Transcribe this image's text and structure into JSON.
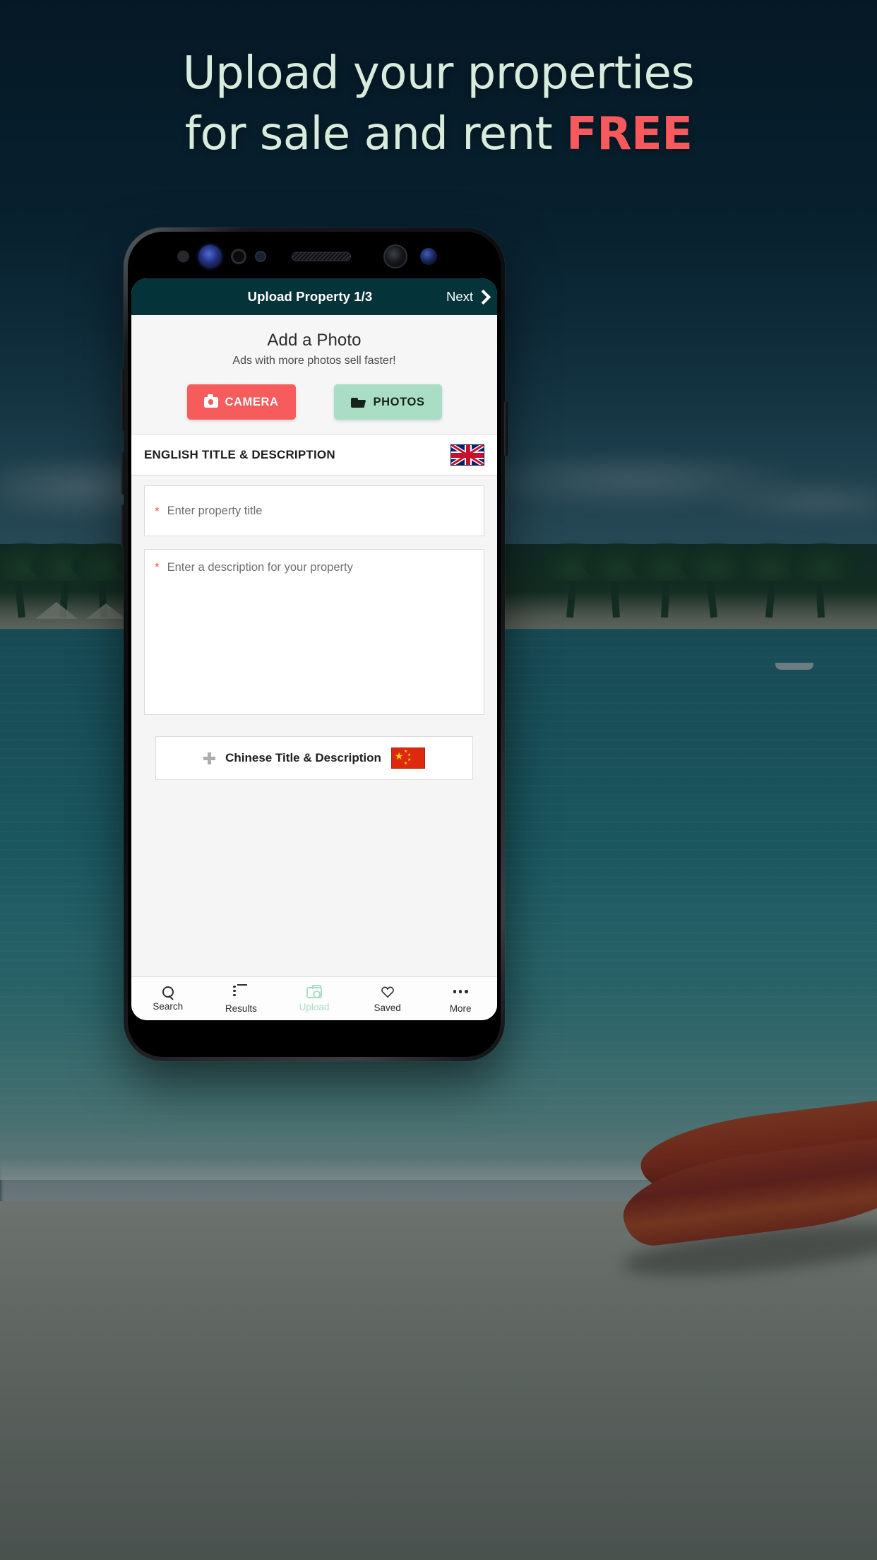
{
  "promo": {
    "line1": "Upload your properties",
    "line2_prefix": "for sale and rent ",
    "line2_highlight": "FREE",
    "text_color": "#d8ecdd",
    "highlight_color": "#f8595c"
  },
  "app": {
    "appbar": {
      "title": "Upload Property 1/3",
      "next_label": "Next",
      "background": "#05333a"
    },
    "photo_section": {
      "title": "Add a Photo",
      "subtitle": "Ads with more photos sell faster!",
      "camera_button": "CAMERA",
      "photos_button": "PHOTOS",
      "camera_color": "#f75c5c",
      "photos_color": "#a9dec5"
    },
    "language_section": {
      "header": "ENGLISH TITLE & DESCRIPTION",
      "flag": "uk-flag-icon",
      "title_field": {
        "required_marker": "*",
        "placeholder": "Enter property title",
        "value": ""
      },
      "description_field": {
        "required_marker": "*",
        "placeholder": "Enter a description for your property",
        "value": ""
      }
    },
    "add_language": {
      "label": "Chinese Title & Description",
      "flag": "china-flag-icon",
      "icon": "plus-icon"
    },
    "bottom_nav": {
      "items": [
        {
          "label": "Search",
          "icon": "search-icon",
          "active": false
        },
        {
          "label": "Results",
          "icon": "list-icon",
          "active": false
        },
        {
          "label": "Upload",
          "icon": "camera-icon",
          "active": true
        },
        {
          "label": "Saved",
          "icon": "heart-icon",
          "active": false
        },
        {
          "label": "More",
          "icon": "ellipsis-icon",
          "active": false
        }
      ],
      "active_color": "#a9dec5"
    }
  }
}
